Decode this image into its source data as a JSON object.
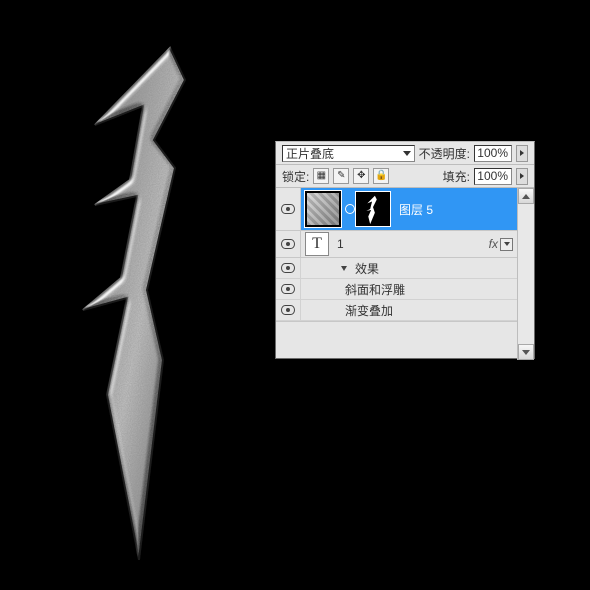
{
  "panel": {
    "blend_mode": "正片叠底",
    "opacity_label": "不透明度:",
    "opacity_value": "100%",
    "lock_label": "锁定:",
    "fill_label": "填充:",
    "fill_value": "100%"
  },
  "layers": {
    "selected": {
      "name": "图层 5"
    },
    "text_layer": {
      "glyph": "T",
      "name": "1",
      "fx_label": "fx"
    },
    "effects": {
      "heading": "效果",
      "items": [
        "斜面和浮雕",
        "渐变叠加"
      ]
    }
  },
  "icons": {
    "lock_pixels": "▦",
    "lock_brush": "✎",
    "lock_move": "✥",
    "lock_all": "🔒"
  }
}
